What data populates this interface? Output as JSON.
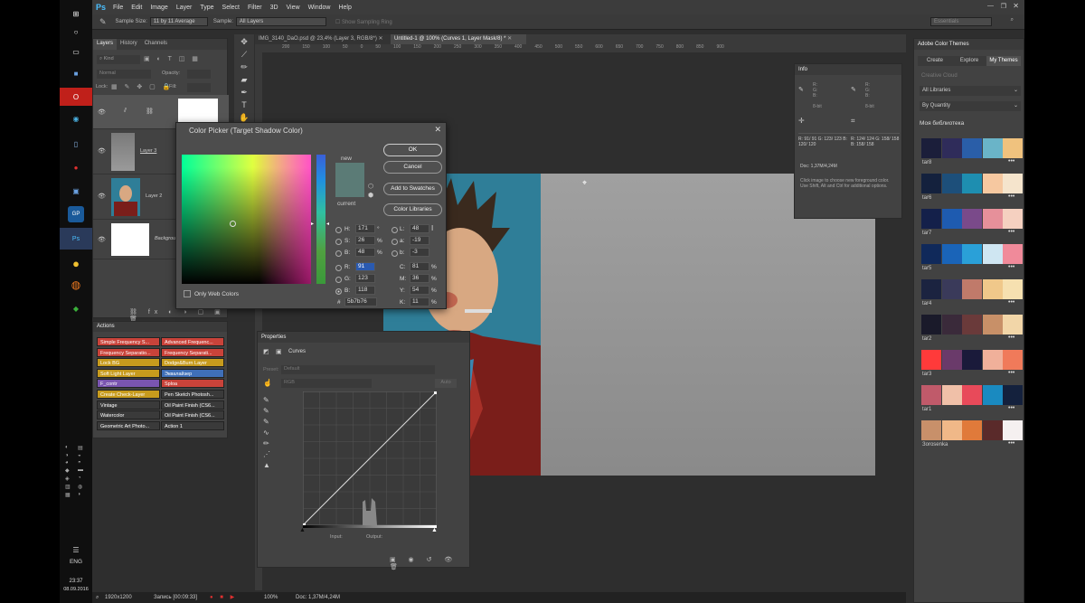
{
  "taskbar": {
    "time": "23:37",
    "date": "08.09.2016",
    "language": "ENG",
    "icons": [
      "windows-logo-icon",
      "search-icon",
      "task-view-icon",
      "user-icon",
      "opera-icon",
      "chrome-icon",
      "file-icon",
      "record-icon",
      "floppy-icon",
      "gp-icon",
      "photoshop-icon",
      "yellow-circle-icon",
      "firefox-icon",
      "stack-icon"
    ]
  },
  "app": {
    "logo": "Ps",
    "menu": [
      "File",
      "Edit",
      "Image",
      "Layer",
      "Type",
      "Select",
      "Filter",
      "3D",
      "View",
      "Window",
      "Help"
    ],
    "options": {
      "sample_size_label": "Sample Size:",
      "sample_size_value": "11 by 11 Average",
      "sample_label": "Sample:",
      "sample_value": "All Layers",
      "show_ring": "Show Sampling Ring",
      "workspace": "Essentials"
    },
    "doc_tabs": [
      "IMG_3140_DaO.psd @ 23,4% (Layer 3, RGB/8*)",
      "Untitled-1 @ 100% (Curves 1, Layer Mask/8) *"
    ],
    "ruler_marks": [
      "200",
      "150",
      "100",
      "50",
      "0",
      "50",
      "100",
      "150",
      "200",
      "250",
      "300",
      "350",
      "400",
      "450",
      "500",
      "550",
      "600",
      "650",
      "700",
      "750",
      "800",
      "850",
      "900"
    ],
    "status": {
      "zoom": "100%",
      "doc": "Doc: 1,37M/4,24M",
      "resolution": "1920x1200",
      "recording": "Запись [00:09:33]"
    }
  },
  "layers_panel": {
    "tabs": [
      "Layers",
      "History",
      "Channels"
    ],
    "kind": "Kind",
    "blend": "Normal",
    "opacity_label": "Opacity:",
    "lock_label": "Lock:",
    "fill_label": "Fill:",
    "layers": [
      {
        "name": ""
      },
      {
        "name": "Layer 3"
      },
      {
        "name": "Layer 2"
      },
      {
        "name": "Backgrou"
      }
    ]
  },
  "actions_panel": {
    "title": "Actions",
    "rows": [
      [
        {
          "label": "Simple Frequency S...",
          "color": "#c9433a"
        },
        {
          "label": "Advanced Frequenc...",
          "color": "#c9433a"
        }
      ],
      [
        {
          "label": "Frequency Separatio...",
          "color": "#c9433a"
        },
        {
          "label": "Frequency Separati...",
          "color": "#c9433a"
        }
      ],
      [
        {
          "label": "Lock BG",
          "color": "#c79b1d"
        },
        {
          "label": "Dodge&Burn Layer",
          "color": "#c79b1d"
        }
      ],
      [
        {
          "label": "Soft Light Layer",
          "color": "#c79b1d"
        },
        {
          "label": "Эквалайзер",
          "color": "#3f6fb8"
        }
      ],
      [
        {
          "label": "F_contr",
          "color": "#7a55b0"
        },
        {
          "label": "Sploa",
          "color": "#c9433a"
        }
      ],
      [
        {
          "label": "Create Check-Layer",
          "color": "#c79b1d"
        },
        {
          "label": "Pen Sketch Photosh...",
          "color": "#3a3a3a"
        }
      ],
      [
        {
          "label": "Vintage",
          "color": "#3a3a3a"
        },
        {
          "label": "Oil Paint Finish (CS6...",
          "color": "#3a3a3a"
        }
      ],
      [
        {
          "label": "Watercolor",
          "color": "#3a3a3a"
        },
        {
          "label": "Oil Paint Finish (CS6...",
          "color": "#3a3a3a"
        }
      ],
      [
        {
          "label": "Geometric Art Photo...",
          "color": "#3a3a3a"
        },
        {
          "label": "Action 1",
          "color": "#3a3a3a"
        }
      ]
    ]
  },
  "color_picker": {
    "title": "Color Picker (Target Shadow Color)",
    "new_label": "new",
    "current_label": "current",
    "ok": "OK",
    "cancel": "Cancel",
    "add_swatches": "Add to Swatches",
    "color_libraries": "Color Libraries",
    "only_web": "Only Web Colors",
    "color_hex": "#5b7b76",
    "hsb": [
      {
        "k": "H:",
        "v": "171",
        "u": "°"
      },
      {
        "k": "S:",
        "v": "26",
        "u": "%"
      },
      {
        "k": "B:",
        "v": "48",
        "u": "%"
      }
    ],
    "rgb": [
      {
        "k": "R:",
        "v": "91"
      },
      {
        "k": "G:",
        "v": "123"
      },
      {
        "k": "B:",
        "v": "118"
      }
    ],
    "lab": [
      {
        "k": "L:",
        "v": "48"
      },
      {
        "k": "a:",
        "v": "-19"
      },
      {
        "k": "b:",
        "v": "-3"
      }
    ],
    "cmyk": [
      {
        "k": "C:",
        "v": "81",
        "u": "%"
      },
      {
        "k": "M:",
        "v": "36",
        "u": "%"
      },
      {
        "k": "Y:",
        "v": "54",
        "u": "%"
      },
      {
        "k": "K:",
        "v": "11",
        "u": "%"
      }
    ],
    "hex_label": "#",
    "hex_value": "5b7b76"
  },
  "properties_panel": {
    "title": "Properties",
    "type_label": "Curves",
    "preset_label": "Preset:",
    "preset_value": "Default",
    "channel": "RGB",
    "auto": "Auto",
    "input_label": "Input:",
    "output_label": "Output:"
  },
  "info_panel": {
    "title": "Info",
    "bit1": "8-bit",
    "bit2": "8-bit",
    "row1": "R: 91/ 91  G: 123/ 123  B: 120/ 120",
    "row2": "R: 124/ 124  G: 158/ 158  B: 158/ 158",
    "doc": "Doc: 1,37M/4,24M",
    "hint": "Click image to choose new foreground color. Use Shift, Alt and Ctrl for additional options."
  },
  "color_themes": {
    "title": "Adobe Color Themes",
    "tabs": [
      "Create",
      "Explore",
      "My Themes"
    ],
    "source": "Creative Cloud",
    "library": "All Libraries",
    "sort": "By Quantity",
    "section": "Моя библиотека",
    "themes": [
      {
        "name": "tar8",
        "colors": [
          "#1b1e3a",
          "#2f2c5a",
          "#2a5ea8",
          "#6ab4c8",
          "#f0c27e"
        ]
      },
      {
        "name": "tar6",
        "colors": [
          "#14213d",
          "#1d4f7a",
          "#1e8eb0",
          "#f6c8a0",
          "#f5e4cc"
        ]
      },
      {
        "name": "tar7",
        "colors": [
          "#14204a",
          "#1e5bb0",
          "#7a4a8a",
          "#e6909a",
          "#f5d0c0"
        ]
      },
      {
        "name": "tar5",
        "colors": [
          "#10295a",
          "#1a64b8",
          "#2aa0d8",
          "#cfe6f2",
          "#f08a9a"
        ]
      },
      {
        "name": "tar4",
        "colors": [
          "#1b2340",
          "#3a3a5a",
          "#c07a6a",
          "#f0c88a",
          "#f6e0b0"
        ]
      },
      {
        "name": "tar2",
        "colors": [
          "#1a1a2a",
          "#3a2a3a",
          "#6a3a3a",
          "#c89068",
          "#f2d6a8"
        ]
      },
      {
        "name": "tar3",
        "colors": [
          "#ff3a3a",
          "#6a3a6a",
          "#1a1a3a",
          "#f0b09a",
          "#f07a5a"
        ]
      },
      {
        "name": "tar1",
        "colors": [
          "#c05a6a",
          "#f0c0a8",
          "#e84a5a",
          "#1a8ac0",
          "#14213d"
        ]
      },
      {
        "name": "Зоrosenka",
        "colors": [
          "#c8906a",
          "#f0b888",
          "#e07a3a",
          "#5a2a2a",
          "#f5f0f0"
        ]
      }
    ]
  }
}
